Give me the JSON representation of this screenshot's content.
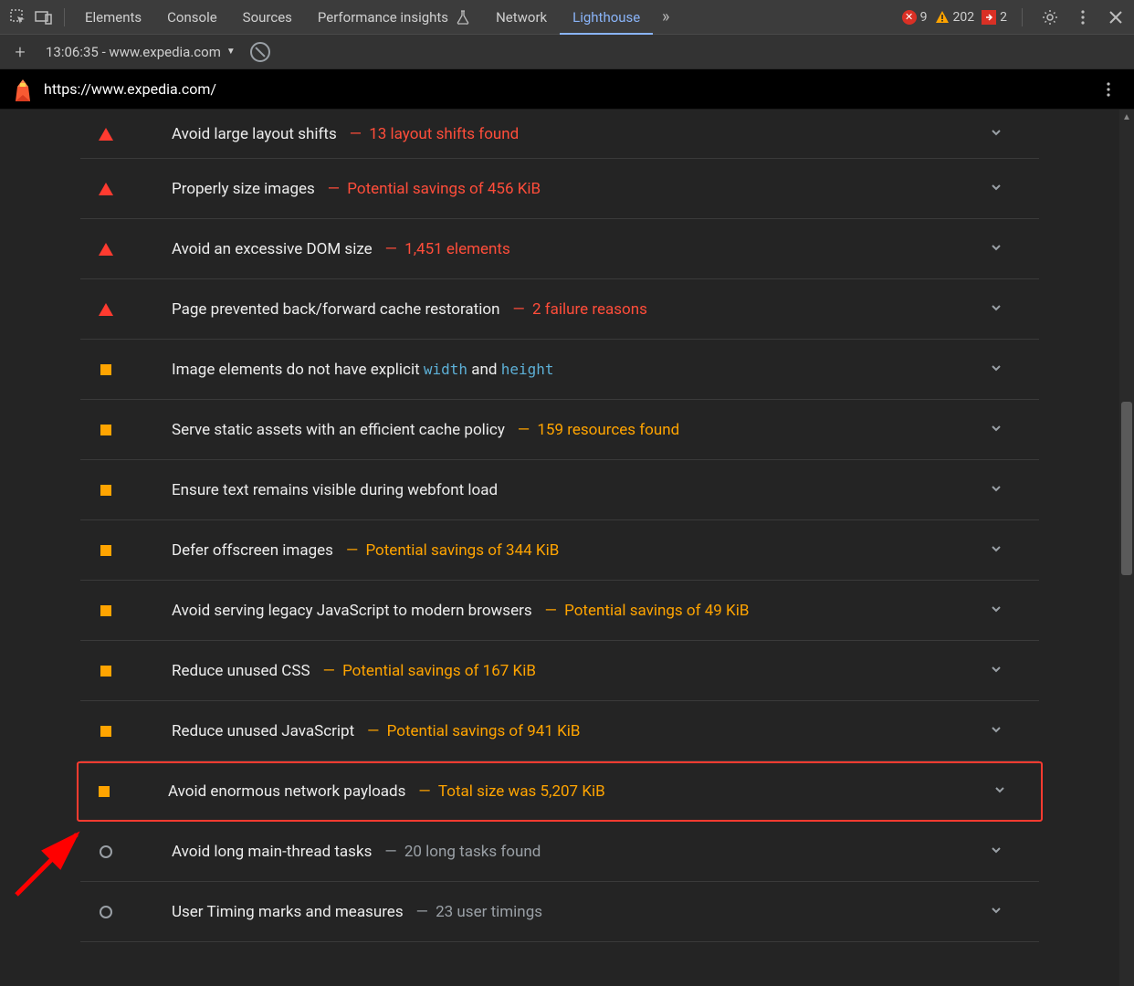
{
  "tabs": {
    "elements": "Elements",
    "console": "Console",
    "sources": "Sources",
    "perf_insights": "Performance insights",
    "network": "Network",
    "lighthouse": "Lighthouse"
  },
  "counts": {
    "errors": "9",
    "warnings": "202",
    "messages": "2"
  },
  "report_selector": "13:06:35 - www.expedia.com",
  "url": "https://www.expedia.com/",
  "audits": [
    {
      "sev": "red",
      "title": "Avoid large layout shifts",
      "detail": "13 layout shifts found",
      "first": true
    },
    {
      "sev": "red",
      "title": "Properly size images",
      "detail": "Potential savings of 456 KiB"
    },
    {
      "sev": "red",
      "title": "Avoid an excessive DOM size",
      "detail": "1,451 elements"
    },
    {
      "sev": "red",
      "title": "Page prevented back/forward cache restoration",
      "detail": "2 failure reasons"
    },
    {
      "sev": "orange",
      "title_html": "Image elements do not have explicit <span class=\"code\">width</span> and <span class=\"code\">height</span>",
      "detail": ""
    },
    {
      "sev": "orange",
      "title": "Serve static assets with an efficient cache policy",
      "detail": "159 resources found"
    },
    {
      "sev": "orange",
      "title": "Ensure text remains visible during webfont load",
      "detail": ""
    },
    {
      "sev": "orange",
      "title": "Defer offscreen images",
      "detail": "Potential savings of 344 KiB"
    },
    {
      "sev": "orange",
      "title": "Avoid serving legacy JavaScript to modern browsers",
      "detail": "Potential savings of 49 KiB"
    },
    {
      "sev": "orange",
      "title": "Reduce unused CSS",
      "detail": "Potential savings of 167 KiB"
    },
    {
      "sev": "orange",
      "title": "Reduce unused JavaScript",
      "detail": "Potential savings of 941 KiB"
    },
    {
      "sev": "orange",
      "title": "Avoid enormous network payloads",
      "detail": "Total size was 5,207 KiB",
      "highlight": true
    },
    {
      "sev": "gray",
      "title": "Avoid long main-thread tasks",
      "detail": "20 long tasks found"
    },
    {
      "sev": "gray",
      "title": "User Timing marks and measures",
      "detail": "23 user timings"
    }
  ]
}
